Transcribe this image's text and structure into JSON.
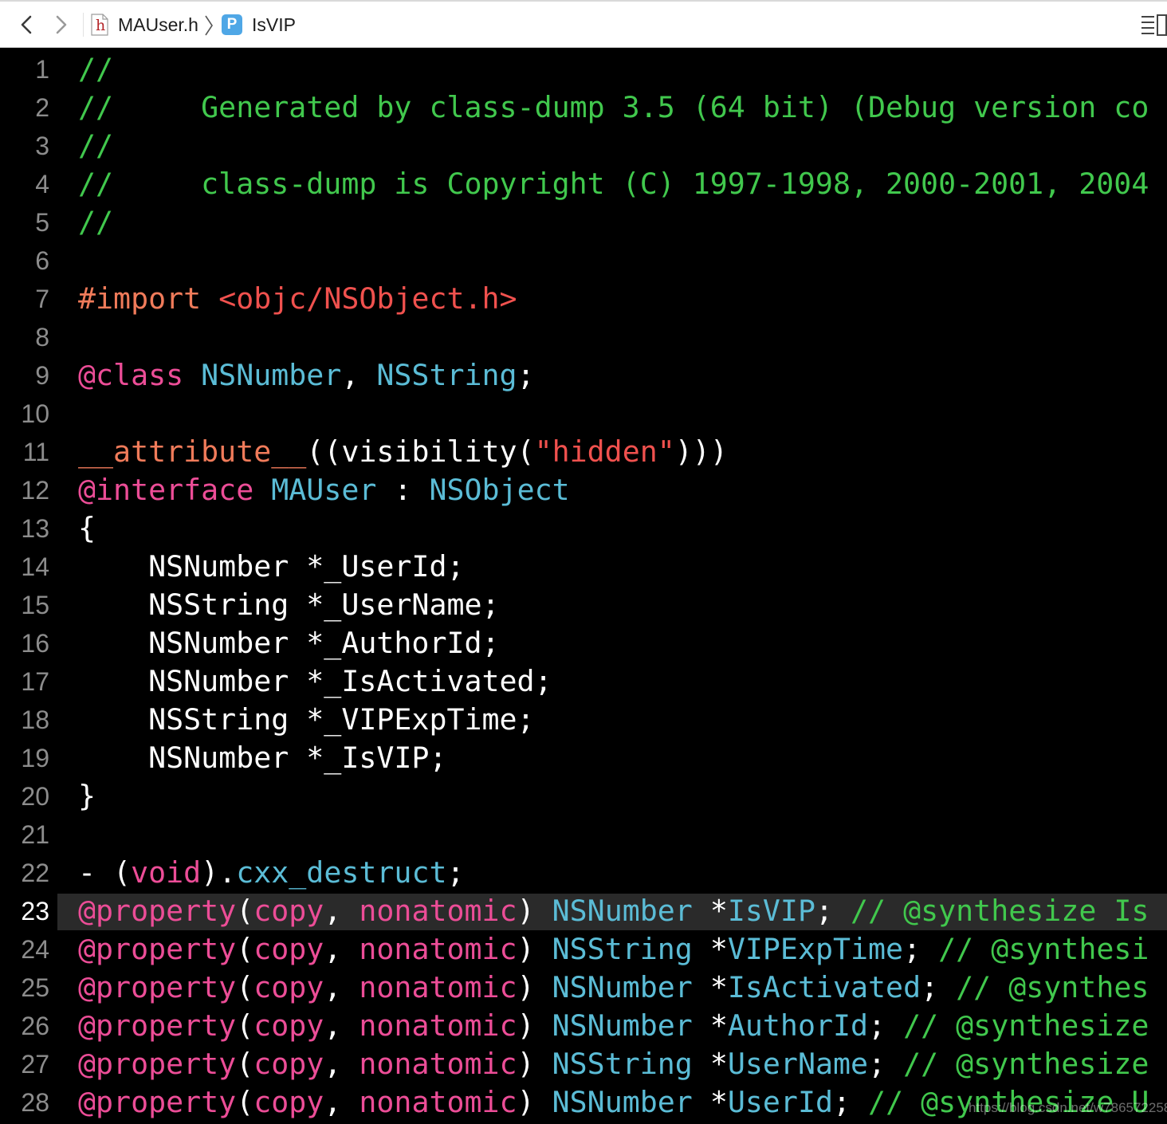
{
  "jumpbar": {
    "file_name": "MAUser.h",
    "file_icon_letter": "h",
    "symbol_name": "IsVIP",
    "symbol_icon_letter": "P"
  },
  "editor": {
    "current_line": 23,
    "lines": [
      {
        "n": "1",
        "tokens": [
          {
            "t": "//",
            "c": "comment"
          }
        ]
      },
      {
        "n": "2",
        "tokens": [
          {
            "t": "//     Generated by class-dump 3.5 (64 bit) (Debug version co",
            "c": "comment"
          }
        ]
      },
      {
        "n": "3",
        "tokens": [
          {
            "t": "//",
            "c": "comment"
          }
        ]
      },
      {
        "n": "4",
        "tokens": [
          {
            "t": "//     class-dump is Copyright (C) 1997-1998, 2000-2001, 2004",
            "c": "comment"
          }
        ]
      },
      {
        "n": "5",
        "tokens": [
          {
            "t": "//",
            "c": "comment"
          }
        ]
      },
      {
        "n": "6",
        "tokens": []
      },
      {
        "n": "7",
        "tokens": [
          {
            "t": "#import ",
            "c": "pre"
          },
          {
            "t": "<objc/NSObject.h>",
            "c": "str"
          }
        ]
      },
      {
        "n": "8",
        "tokens": []
      },
      {
        "n": "9",
        "tokens": [
          {
            "t": "@class ",
            "c": "kw"
          },
          {
            "t": "NSNumber",
            "c": "type"
          },
          {
            "t": ", ",
            "c": "plain"
          },
          {
            "t": "NSString",
            "c": "type"
          },
          {
            "t": ";",
            "c": "plain"
          }
        ]
      },
      {
        "n": "10",
        "tokens": []
      },
      {
        "n": "11",
        "tokens": [
          {
            "t": "__attribute__",
            "c": "pre"
          },
          {
            "t": "((visibility(",
            "c": "plain"
          },
          {
            "t": "\"hidden\"",
            "c": "str"
          },
          {
            "t": ")))",
            "c": "plain"
          }
        ]
      },
      {
        "n": "12",
        "tokens": [
          {
            "t": "@interface ",
            "c": "kw"
          },
          {
            "t": "MAUser",
            "c": "type"
          },
          {
            "t": " : ",
            "c": "plain"
          },
          {
            "t": "NSObject",
            "c": "type"
          }
        ]
      },
      {
        "n": "13",
        "tokens": [
          {
            "t": "{",
            "c": "plain"
          }
        ]
      },
      {
        "n": "14",
        "tokens": [
          {
            "t": "    NSNumber *_UserId;",
            "c": "plain"
          }
        ]
      },
      {
        "n": "15",
        "tokens": [
          {
            "t": "    NSString *_UserName;",
            "c": "plain"
          }
        ]
      },
      {
        "n": "16",
        "tokens": [
          {
            "t": "    NSNumber *_AuthorId;",
            "c": "plain"
          }
        ]
      },
      {
        "n": "17",
        "tokens": [
          {
            "t": "    NSNumber *_IsActivated;",
            "c": "plain"
          }
        ]
      },
      {
        "n": "18",
        "tokens": [
          {
            "t": "    NSString *_VIPExpTime;",
            "c": "plain"
          }
        ]
      },
      {
        "n": "19",
        "tokens": [
          {
            "t": "    NSNumber *_IsVIP;",
            "c": "plain"
          }
        ]
      },
      {
        "n": "20",
        "tokens": [
          {
            "t": "}",
            "c": "plain"
          }
        ]
      },
      {
        "n": "21",
        "tokens": []
      },
      {
        "n": "22",
        "tokens": [
          {
            "t": "- (",
            "c": "plain"
          },
          {
            "t": "void",
            "c": "kw"
          },
          {
            "t": ").",
            "c": "plain"
          },
          {
            "t": "cxx_destruct",
            "c": "type"
          },
          {
            "t": ";",
            "c": "plain"
          }
        ]
      },
      {
        "n": "23",
        "tokens": [
          {
            "t": "@property",
            "c": "kw"
          },
          {
            "t": "(",
            "c": "plain"
          },
          {
            "t": "copy",
            "c": "kw"
          },
          {
            "t": ", ",
            "c": "plain"
          },
          {
            "t": "nonatomic",
            "c": "kw"
          },
          {
            "t": ") ",
            "c": "plain"
          },
          {
            "t": "NSNumber",
            "c": "type"
          },
          {
            "t": " *",
            "c": "plain"
          },
          {
            "t": "IsVIP",
            "c": "type"
          },
          {
            "t": "; ",
            "c": "plain"
          },
          {
            "t": "// @synthesize Is",
            "c": "comment"
          }
        ]
      },
      {
        "n": "24",
        "tokens": [
          {
            "t": "@property",
            "c": "kw"
          },
          {
            "t": "(",
            "c": "plain"
          },
          {
            "t": "copy",
            "c": "kw"
          },
          {
            "t": ", ",
            "c": "plain"
          },
          {
            "t": "nonatomic",
            "c": "kw"
          },
          {
            "t": ") ",
            "c": "plain"
          },
          {
            "t": "NSString",
            "c": "type"
          },
          {
            "t": " *",
            "c": "plain"
          },
          {
            "t": "VIPExpTime",
            "c": "type"
          },
          {
            "t": "; ",
            "c": "plain"
          },
          {
            "t": "// @synthesi",
            "c": "comment"
          }
        ]
      },
      {
        "n": "25",
        "tokens": [
          {
            "t": "@property",
            "c": "kw"
          },
          {
            "t": "(",
            "c": "plain"
          },
          {
            "t": "copy",
            "c": "kw"
          },
          {
            "t": ", ",
            "c": "plain"
          },
          {
            "t": "nonatomic",
            "c": "kw"
          },
          {
            "t": ") ",
            "c": "plain"
          },
          {
            "t": "NSNumber",
            "c": "type"
          },
          {
            "t": " *",
            "c": "plain"
          },
          {
            "t": "IsActivated",
            "c": "type"
          },
          {
            "t": "; ",
            "c": "plain"
          },
          {
            "t": "// @synthes",
            "c": "comment"
          }
        ]
      },
      {
        "n": "26",
        "tokens": [
          {
            "t": "@property",
            "c": "kw"
          },
          {
            "t": "(",
            "c": "plain"
          },
          {
            "t": "copy",
            "c": "kw"
          },
          {
            "t": ", ",
            "c": "plain"
          },
          {
            "t": "nonatomic",
            "c": "kw"
          },
          {
            "t": ") ",
            "c": "plain"
          },
          {
            "t": "NSNumber",
            "c": "type"
          },
          {
            "t": " *",
            "c": "plain"
          },
          {
            "t": "AuthorId",
            "c": "type"
          },
          {
            "t": "; ",
            "c": "plain"
          },
          {
            "t": "// @synthesize",
            "c": "comment"
          }
        ]
      },
      {
        "n": "27",
        "tokens": [
          {
            "t": "@property",
            "c": "kw"
          },
          {
            "t": "(",
            "c": "plain"
          },
          {
            "t": "copy",
            "c": "kw"
          },
          {
            "t": ", ",
            "c": "plain"
          },
          {
            "t": "nonatomic",
            "c": "kw"
          },
          {
            "t": ") ",
            "c": "plain"
          },
          {
            "t": "NSString",
            "c": "type"
          },
          {
            "t": " *",
            "c": "plain"
          },
          {
            "t": "UserName",
            "c": "type"
          },
          {
            "t": "; ",
            "c": "plain"
          },
          {
            "t": "// @synthesize",
            "c": "comment"
          }
        ]
      },
      {
        "n": "28",
        "tokens": [
          {
            "t": "@property",
            "c": "kw"
          },
          {
            "t": "(",
            "c": "plain"
          },
          {
            "t": "copy",
            "c": "kw"
          },
          {
            "t": ", ",
            "c": "plain"
          },
          {
            "t": "nonatomic",
            "c": "kw"
          },
          {
            "t": ") ",
            "c": "plain"
          },
          {
            "t": "NSNumber",
            "c": "type"
          },
          {
            "t": " *",
            "c": "plain"
          },
          {
            "t": "UserId",
            "c": "type"
          },
          {
            "t": "; ",
            "c": "plain"
          },
          {
            "t": "// @synthesize U",
            "c": "comment"
          }
        ]
      }
    ]
  },
  "watermark": "https://blog.csdn.net/w786572258",
  "colors": {
    "background": "#000000",
    "comment": "#41c84d",
    "preprocessor": "#f07b5a",
    "string": "#f0514e",
    "keyword": "#ec4d97",
    "type": "#5bbcd6",
    "plain": "#ffffff",
    "line_number": "#8c8c8c",
    "current_line_bg": "#2a2a2a"
  }
}
